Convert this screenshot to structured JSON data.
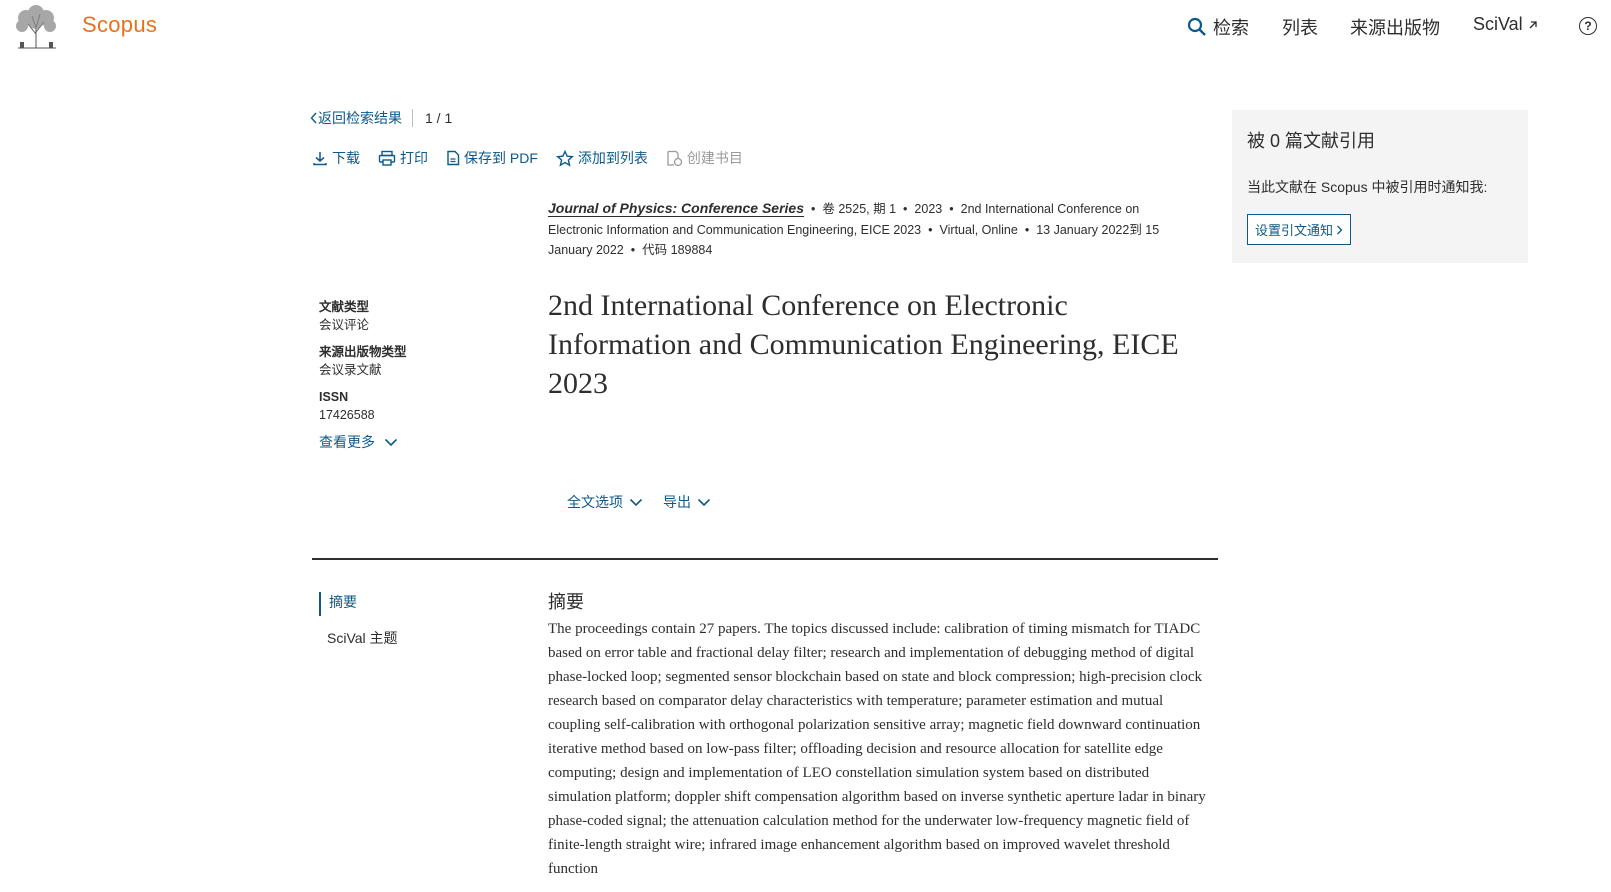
{
  "header": {
    "brand": "Scopus",
    "nav": {
      "search": "检索",
      "lists": "列表",
      "sources": "来源出版物",
      "scival": "SciVal"
    },
    "help": "?"
  },
  "back": {
    "label": "返回检索结果",
    "page": "1 / 1"
  },
  "toolbar": {
    "download": "下载",
    "print": "打印",
    "save_pdf": "保存到 PDF",
    "add_list": "添加到列表",
    "bibliography": "创建书目"
  },
  "source": {
    "journal": "Journal of Physics: Conference Series",
    "volume": "卷 2525, 期 1",
    "year": "2023",
    "conference": "2nd International Conference on Electronic Information and Communication Engineering, EICE 2023",
    "location": "Virtual, Online",
    "dates": "13 January 2022到 15 January 2022",
    "code": "代码 189884"
  },
  "meta": {
    "doc_type_label": "文献类型",
    "doc_type": "会议评论",
    "source_type_label": "来源出版物类型",
    "source_type": "会议录文献",
    "issn_label": "ISSN",
    "issn": "17426588",
    "see_more": "查看更多"
  },
  "title": "2nd International Conference on Electronic Information and Communication Engineering, EICE 2023",
  "options": {
    "full_text": "全文选项",
    "export": "导出"
  },
  "tabs": {
    "abstract": "摘要",
    "scival_topics": "SciVal 主题"
  },
  "abstract": {
    "heading": "摘要",
    "text": "The proceedings contain 27 papers. The topics discussed include: calibration of timing mismatch for TIADC based on error table and fractional delay filter; research and implementation of debugging method of digital phase-locked loop; segmented sensor blockchain based on state and block compression; high-precision clock research based on comparator delay characteristics with temperature; parameter estimation and mutual coupling self-calibration with orthogonal polarization sensitive array; magnetic field downward continuation iterative method based on low-pass filter; offloading decision and resource allocation for satellite edge computing; design and implementation of LEO constellation simulation system based on distributed simulation platform; doppler shift compensation algorithm based on inverse synthetic aperture ladar in binary phase-coded signal; the attenuation calculation method for the underwater low-frequency magnetic field of finite-length straight wire; infrared image enhancement algorithm based on improved wavelet threshold function"
  },
  "cited_by": {
    "heading": "被 0 篇文献引用",
    "notify_text": "当此文献在 Scopus 中被引用时通知我:",
    "button": "设置引文通知"
  },
  "colors": {
    "brand_orange": "#e9711c",
    "link_blue": "#0c5a8a",
    "panel_grey": "#f4f4f4"
  }
}
